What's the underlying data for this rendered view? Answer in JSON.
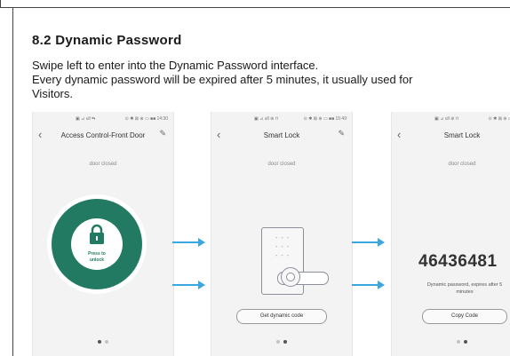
{
  "heading": "8.2 Dynamic Password",
  "body": {
    "line1": "Swipe left to enter into the Dynamic Password interface.",
    "line2": "Every dynamic password will be expired after 5 minutes, it usually used for",
    "line3": "Visitors."
  },
  "colors": {
    "accent_green": "#237a63",
    "arrow_blue": "#3aa7e0"
  },
  "screens": [
    {
      "status_center": "▣ ⊿ ull ⇆",
      "status_right": "⊙ ✱ ⊠ ⊕ ▭ ■■ 14:30",
      "back_icon": "chevron-left-icon",
      "title": "Access Control-Front Door",
      "edit_icon": "pencil-icon",
      "state": "door closed",
      "unlock_label_1": "Press to",
      "unlock_label_2": "unlock",
      "pager_active": 0
    },
    {
      "status_center": "▣ ⊿ ull ⊕ ⊓",
      "status_right": "⊙ ✱ ⊠ ⊕ ▭ ■■ 15:49",
      "title": "Smart Lock",
      "state": "door closed",
      "door_marks": "- - -",
      "button": "Get dynamic code",
      "pager_active": 1
    },
    {
      "status_center": "▣ ⊿ ull ⊕ ⊓",
      "status_right": "⊙ ✱ ⊠ ⊕ ▭ ■",
      "title": "Smart Lock",
      "state": "door closed",
      "code": "46436481",
      "note_1": "Dynamic password, expires after 5",
      "note_2": "minutes",
      "button": "Copy Code",
      "pager_active": 1
    }
  ]
}
